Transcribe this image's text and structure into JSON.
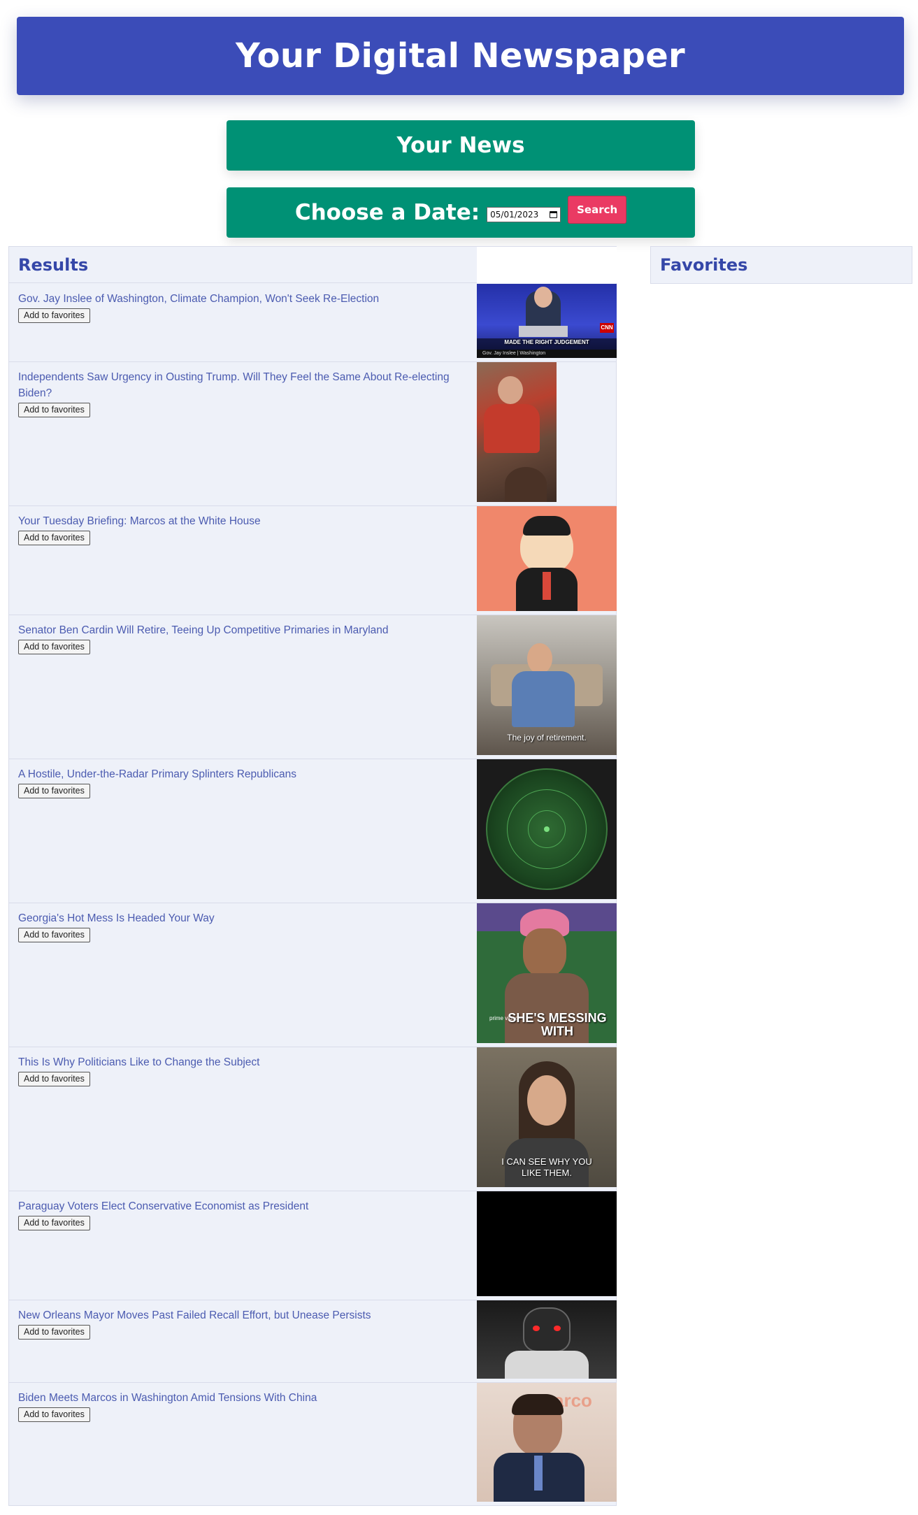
{
  "header": {
    "title": "Your Digital Newspaper"
  },
  "nav": {
    "your_news": "Your News"
  },
  "date_bar": {
    "label": "Choose a Date:",
    "date_value": "05/01/2023",
    "search_label": "Search"
  },
  "results": {
    "heading": "Results",
    "items": [
      {
        "title": "Gov. Jay Inslee of Washington, Climate Champion, Won't Seek Re-Election",
        "button": "Add to favorites",
        "gif_caption": "MADE THE RIGHT JUDGEMENT",
        "gif_lower_third": "Gov. Jay Inslee | Washington"
      },
      {
        "title": "Independents Saw Urgency in Ousting Trump. Will They Feel the Same About Re-electing Biden?",
        "button": "Add to favorites",
        "gif_caption": ""
      },
      {
        "title": "Your Tuesday Briefing: Marcos at the White House",
        "button": "Add to favorites",
        "gif_caption": ""
      },
      {
        "title": "Senator Ben Cardin Will Retire, Teeing Up Competitive Primaries in Maryland",
        "button": "Add to favorites",
        "gif_caption": "The joy of retirement."
      },
      {
        "title": "A Hostile, Under-the-Radar Primary Splinters Republicans",
        "button": "Add to favorites",
        "gif_caption": ""
      },
      {
        "title": "Georgia's Hot Mess Is Headed Your Way",
        "button": "Add to favorites",
        "gif_caption": "SHE'S MESSING WITH",
        "gif_brand": "prime video"
      },
      {
        "title": "This Is Why Politicians Like to Change the Subject",
        "button": "Add to favorites",
        "gif_caption": "I CAN SEE WHY YOU LIKE THEM."
      },
      {
        "title": "Paraguay Voters Elect Conservative Economist as President",
        "button": "Add to favorites",
        "gif_caption": ""
      },
      {
        "title": "New Orleans Mayor Moves Past Failed Recall Effort, but Unease Persists",
        "button": "Add to favorites",
        "gif_caption": ""
      },
      {
        "title": "Biden Meets Marcos in Washington Amid Tensions With China",
        "button": "Add to favorites",
        "gif_caption": ""
      }
    ]
  },
  "favorites": {
    "heading": "Favorites"
  },
  "colors": {
    "header": "#3b4cb8",
    "green": "#009175",
    "search": "#ea3a63",
    "panel": "#eef1f9",
    "link": "#4b5bb0"
  }
}
